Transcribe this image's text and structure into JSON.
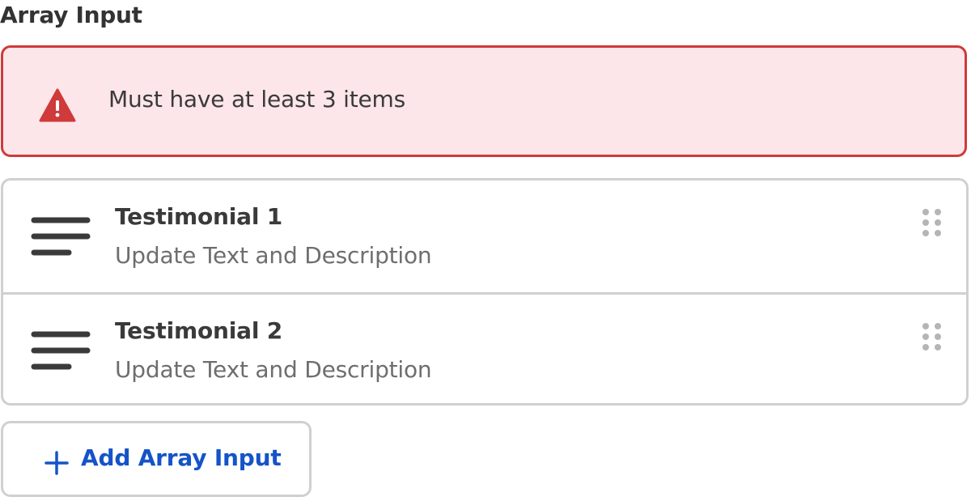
{
  "field": {
    "label": "Array Input"
  },
  "error": {
    "icon": "warning-triangle-icon",
    "message": "Must have at least 3 items",
    "color": "#cf3a3a",
    "background": "#fde6e9"
  },
  "items": [
    {
      "title": "Testimonial 1",
      "subtitle": "Update Text and Description",
      "icon": "text-lines-icon"
    },
    {
      "title": "Testimonial 2",
      "subtitle": "Update Text and Description",
      "icon": "text-lines-icon"
    }
  ],
  "add_button": {
    "label": "Add Array Input",
    "icon": "plus-icon",
    "color": "#1553c8"
  }
}
